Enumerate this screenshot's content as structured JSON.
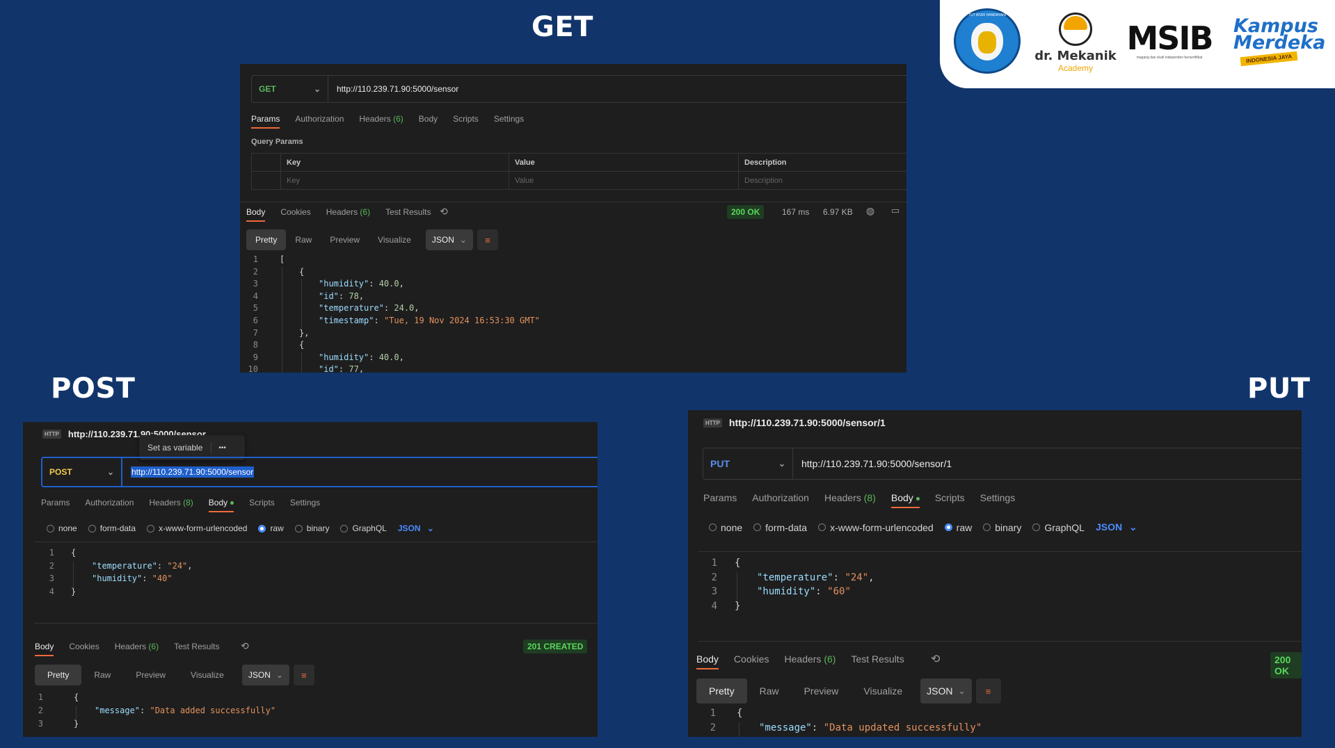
{
  "titles": {
    "get": "GET",
    "post": "POST",
    "put": "PUT"
  },
  "logos": {
    "mekanik_name": "dr. Mekanik",
    "mekanik_sub": "Academy",
    "msib": "MSIB",
    "msib_tagline": "magang dan studi independen bersertifikat",
    "kampus": "Kampus Merdeka",
    "kampus_band": "INDONESIA JAYA",
    "tut_wuri": "TUT WURI HANDAYANI"
  },
  "get_panel": {
    "method": "GET",
    "url": "http://110.239.71.90:5000/sensor",
    "tabs": [
      {
        "label": "Params"
      },
      {
        "label": "Authorization"
      },
      {
        "label": "Headers",
        "count": "(6)"
      },
      {
        "label": "Body"
      },
      {
        "label": "Scripts"
      },
      {
        "label": "Settings"
      }
    ],
    "query_params_label": "Query Params",
    "table_headers": [
      "Key",
      "Value",
      "Description"
    ],
    "table_placeholders": [
      "Key",
      "Value",
      "Description"
    ],
    "resp_tabs": [
      {
        "label": "Body"
      },
      {
        "label": "Cookies"
      },
      {
        "label": "Headers",
        "count": "(6)"
      },
      {
        "label": "Test Results"
      }
    ],
    "status": "200 OK",
    "time": "167 ms",
    "size": "6.97 KB",
    "formats": [
      "Pretty",
      "Raw",
      "Preview",
      "Visualize"
    ],
    "format_select": "JSON",
    "code": [
      {
        "n": "1",
        "indent": 0,
        "t": [
          [
            "pun",
            "["
          ]
        ]
      },
      {
        "n": "2",
        "indent": 1,
        "t": [
          [
            "pun",
            "{"
          ]
        ]
      },
      {
        "n": "3",
        "indent": 2,
        "t": [
          [
            "key",
            "\"humidity\""
          ],
          [
            "pun",
            ": "
          ],
          [
            "num",
            "40.0"
          ],
          [
            "pun",
            ","
          ]
        ]
      },
      {
        "n": "4",
        "indent": 2,
        "t": [
          [
            "key",
            "\"id\""
          ],
          [
            "pun",
            ": "
          ],
          [
            "num",
            "78"
          ],
          [
            "pun",
            ","
          ]
        ]
      },
      {
        "n": "5",
        "indent": 2,
        "t": [
          [
            "key",
            "\"temperature\""
          ],
          [
            "pun",
            ": "
          ],
          [
            "num",
            "24.0"
          ],
          [
            "pun",
            ","
          ]
        ]
      },
      {
        "n": "6",
        "indent": 2,
        "t": [
          [
            "key",
            "\"timestamp\""
          ],
          [
            "pun",
            ": "
          ],
          [
            "str",
            "\"Tue, 19 Nov 2024 16:53:30 GMT\""
          ]
        ]
      },
      {
        "n": "7",
        "indent": 1,
        "t": [
          [
            "pun",
            "},"
          ]
        ]
      },
      {
        "n": "8",
        "indent": 1,
        "t": [
          [
            "pun",
            "{"
          ]
        ]
      },
      {
        "n": "9",
        "indent": 2,
        "t": [
          [
            "key",
            "\"humidity\""
          ],
          [
            "pun",
            ": "
          ],
          [
            "num",
            "40.0"
          ],
          [
            "pun",
            ","
          ]
        ]
      },
      {
        "n": "10",
        "indent": 2,
        "t": [
          [
            "key",
            "\"id\""
          ],
          [
            "pun",
            ": "
          ],
          [
            "num",
            "77"
          ],
          [
            "pun",
            ","
          ]
        ]
      }
    ]
  },
  "post_panel": {
    "header_url": "http://110.239.71.90:5000/sensor",
    "popup_label": "Set as variable",
    "popup_more": "•••",
    "method": "POST",
    "url": "http://110.239.71.90:5000/sensor",
    "tabs": [
      {
        "label": "Params"
      },
      {
        "label": "Authorization"
      },
      {
        "label": "Headers",
        "count": "(8)"
      },
      {
        "label": "Body",
        "dot": true
      },
      {
        "label": "Scripts"
      },
      {
        "label": "Settings"
      }
    ],
    "body_types": [
      "none",
      "form-data",
      "x-www-form-urlencoded",
      "raw",
      "binary",
      "GraphQL"
    ],
    "body_format": "JSON",
    "req_code": [
      {
        "n": "1",
        "indent": 0,
        "t": [
          [
            "pun",
            "{"
          ]
        ]
      },
      {
        "n": "2",
        "indent": 1,
        "t": [
          [
            "key",
            "\"temperature\""
          ],
          [
            "pun",
            ": "
          ],
          [
            "str",
            "\"24\""
          ],
          [
            "pun",
            ","
          ]
        ]
      },
      {
        "n": "3",
        "indent": 1,
        "t": [
          [
            "key",
            "\"humidity\""
          ],
          [
            "pun",
            ": "
          ],
          [
            "str",
            "\"40\""
          ]
        ]
      },
      {
        "n": "4",
        "indent": 0,
        "t": [
          [
            "pun",
            "}"
          ]
        ]
      }
    ],
    "resp_tabs": [
      {
        "label": "Body"
      },
      {
        "label": "Cookies"
      },
      {
        "label": "Headers",
        "count": "(6)"
      },
      {
        "label": "Test Results"
      }
    ],
    "status": "201 CREATED",
    "formats": [
      "Pretty",
      "Raw",
      "Preview",
      "Visualize"
    ],
    "format_select": "JSON",
    "resp_code": [
      {
        "n": "1",
        "indent": 0,
        "t": [
          [
            "pun",
            "{"
          ]
        ]
      },
      {
        "n": "2",
        "indent": 1,
        "t": [
          [
            "key",
            "\"message\""
          ],
          [
            "pun",
            ": "
          ],
          [
            "str",
            "\"Data added successfully\""
          ]
        ]
      },
      {
        "n": "3",
        "indent": 0,
        "t": [
          [
            "pun",
            "}"
          ]
        ]
      }
    ]
  },
  "put_panel": {
    "header_url": "http://110.239.71.90:5000/sensor/1",
    "method": "PUT",
    "url": "http://110.239.71.90:5000/sensor/1",
    "tabs": [
      {
        "label": "Params"
      },
      {
        "label": "Authorization"
      },
      {
        "label": "Headers",
        "count": "(8)"
      },
      {
        "label": "Body",
        "dot": true
      },
      {
        "label": "Scripts"
      },
      {
        "label": "Settings"
      }
    ],
    "body_types": [
      "none",
      "form-data",
      "x-www-form-urlencoded",
      "raw",
      "binary",
      "GraphQL"
    ],
    "body_format": "JSON",
    "req_code": [
      {
        "n": "1",
        "indent": 0,
        "t": [
          [
            "pun",
            "{"
          ]
        ]
      },
      {
        "n": "2",
        "indent": 1,
        "t": [
          [
            "key",
            "\"temperature\""
          ],
          [
            "pun",
            ": "
          ],
          [
            "str",
            "\"24\""
          ],
          [
            "pun",
            ","
          ]
        ]
      },
      {
        "n": "3",
        "indent": 1,
        "t": [
          [
            "key",
            "\"humidity\""
          ],
          [
            "pun",
            ": "
          ],
          [
            "str",
            "\"60\""
          ]
        ]
      },
      {
        "n": "4",
        "indent": 0,
        "t": [
          [
            "pun",
            "}"
          ]
        ]
      }
    ],
    "resp_tabs": [
      {
        "label": "Body"
      },
      {
        "label": "Cookies"
      },
      {
        "label": "Headers",
        "count": "(6)"
      },
      {
        "label": "Test Results"
      }
    ],
    "status": "200 OK",
    "formats": [
      "Pretty",
      "Raw",
      "Preview",
      "Visualize"
    ],
    "format_select": "JSON",
    "resp_code": [
      {
        "n": "1",
        "indent": 0,
        "t": [
          [
            "pun",
            "{"
          ]
        ]
      },
      {
        "n": "2",
        "indent": 1,
        "t": [
          [
            "key",
            "\"message\""
          ],
          [
            "pun",
            ": "
          ],
          [
            "str",
            "\"Data updated successfully\""
          ]
        ]
      }
    ]
  },
  "colors": {
    "background": "#11356b",
    "panel": "#1e1e1e",
    "get_method": "#5cb85c",
    "post_method": "#f2c94c",
    "put_method": "#5b8def",
    "accent": "#f06a3a",
    "status_ok": "#4caf50",
    "url_selected": "#1f5fcc"
  },
  "icons": {
    "history": "history-icon",
    "globe": "globe-icon",
    "save_response": "save-response-icon",
    "wrap": "wrap-lines-icon",
    "http": "http-icon",
    "chevron": "chevron-down-icon"
  }
}
